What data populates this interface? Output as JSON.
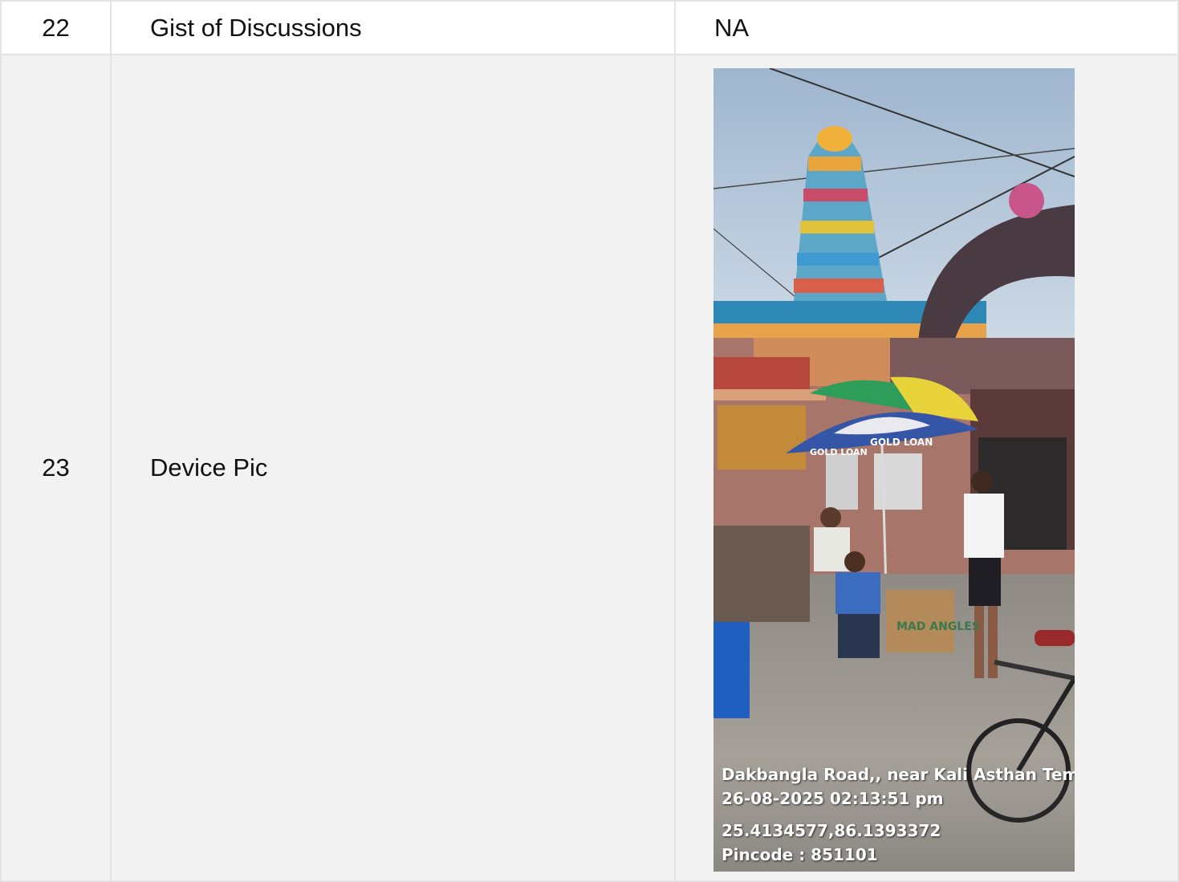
{
  "rows": [
    {
      "number": "22",
      "label": "Gist of Discussions",
      "value": "NA"
    },
    {
      "number": "23",
      "label": "Device Pic"
    }
  ],
  "photo_stamp": {
    "location": "Dakbangla Road,, near Kali Asthan Temple, ...",
    "datetime": "26-08-2025 02:13:51 pm",
    "coordinates": "25.4134577,86.1393372",
    "pincode": "Pincode : 851101"
  },
  "photo_signage": {
    "umbrella_text_1": "GOLD LOAN",
    "umbrella_text_2": "GOLD LOAN",
    "box_text": "MAD ANGLES"
  }
}
